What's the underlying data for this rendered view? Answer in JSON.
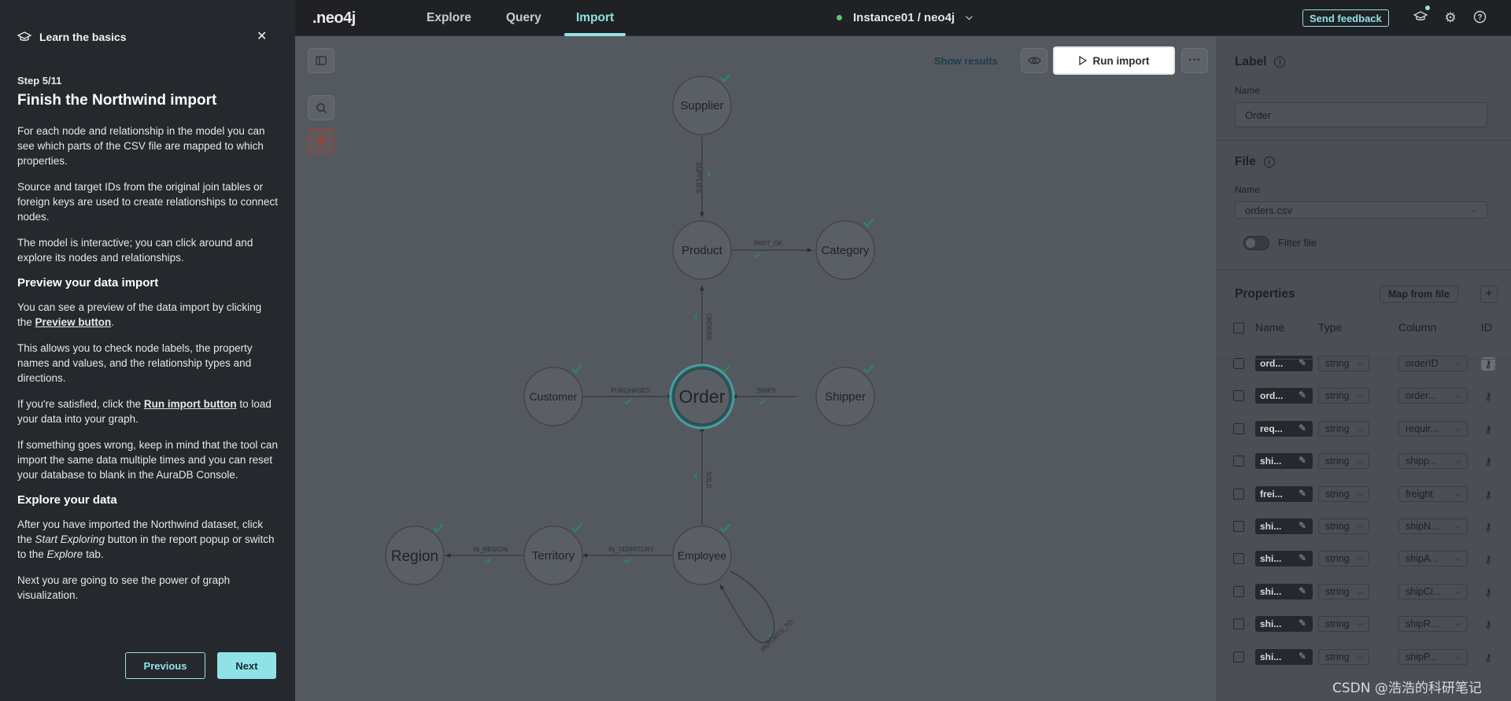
{
  "guide": {
    "header": "Learn the basics",
    "step": "Step 5/11",
    "title": "Finish the Northwind import",
    "p1": "For each node and relationship in the model you can see which parts of the CSV file are mapped to which properties.",
    "p2": "Source and target IDs from the original join tables or foreign keys are used to create relationships to connect nodes.",
    "p3": "The model is interactive; you can click around and explore its nodes and relationships.",
    "h_preview": "Preview your data import",
    "p4_pre": "You can see a preview of the data import by clicking the ",
    "p4_link": "Preview button",
    "p4_post": ".",
    "p5": "This allows you to check node labels, the property names and values, and the relationship types and directions.",
    "p6_pre": "If you're satisfied, click the ",
    "p6_link": "Run import button",
    "p6_post": " to load your data into your graph.",
    "p7": "If something goes wrong, keep in mind that the tool can import the same data multiple times and you can reset your database to blank in the AuraDB Console.",
    "h_explore": "Explore your data",
    "p8_pre": "After you have imported the Northwind dataset, click the ",
    "p8_em1": "Start Exploring",
    "p8_mid": " button in the report popup or switch to the ",
    "p8_em2": "Explore",
    "p8_post": " tab.",
    "p9": "Next you are going to see the power of graph visualization.",
    "prev": "Previous",
    "next": "Next"
  },
  "topbar": {
    "logo": ".neo4j",
    "nav": [
      "Explore",
      "Query",
      "Import"
    ],
    "active_tab": "Import",
    "instance": "Instance01 / neo4j",
    "feedback": "Send feedback"
  },
  "canvas": {
    "show_results": "Show results",
    "run_import": "Run import",
    "more": "···"
  },
  "graph": {
    "nodes": [
      "Supplier",
      "Product",
      "Category",
      "Customer",
      "Order",
      "Shipper",
      "Region",
      "Territory",
      "Employee"
    ],
    "edges": [
      "SUPPLIES",
      "PART_OF",
      "ORDERS",
      "PURCHASED",
      "SHIPS",
      "SOLD",
      "IN_REGION",
      "IN_TERRITORY",
      "REPORTS_TO"
    ]
  },
  "side": {
    "label_title": "Label",
    "name_label": "Name",
    "label_value": "Order",
    "file_title": "File",
    "file_name_label": "Name",
    "file_value": "orders.csv",
    "filter_label": "Filter file",
    "props_title": "Properties",
    "map_from_file": "Map from file",
    "plus": "+",
    "headers": [
      "Name",
      "Type",
      "Column",
      "ID"
    ],
    "rows": [
      {
        "name": "ord...",
        "type": "string",
        "column": "orderID",
        "key_active": true
      },
      {
        "name": "ord...",
        "type": "string",
        "column": "order...",
        "key_active": false
      },
      {
        "name": "req...",
        "type": "string",
        "column": "requir...",
        "key_active": false
      },
      {
        "name": "shi...",
        "type": "string",
        "column": "shipp...",
        "key_active": false
      },
      {
        "name": "frei...",
        "type": "string",
        "column": "freight",
        "key_active": false
      },
      {
        "name": "shi...",
        "type": "string",
        "column": "shipN...",
        "key_active": false
      },
      {
        "name": "shi...",
        "type": "string",
        "column": "shipA...",
        "key_active": false
      },
      {
        "name": "shi...",
        "type": "string",
        "column": "shipCi...",
        "key_active": false
      },
      {
        "name": "shi...",
        "type": "string",
        "column": "shipR...",
        "key_active": false
      },
      {
        "name": "shi...",
        "type": "string",
        "column": "shipP...",
        "key_active": false
      }
    ]
  },
  "watermark": "CSDN @浩浩的科研笔记",
  "colors": {
    "accent": "#8fe3e8",
    "check": "#2a8c5c",
    "danger": "#b3382f"
  }
}
